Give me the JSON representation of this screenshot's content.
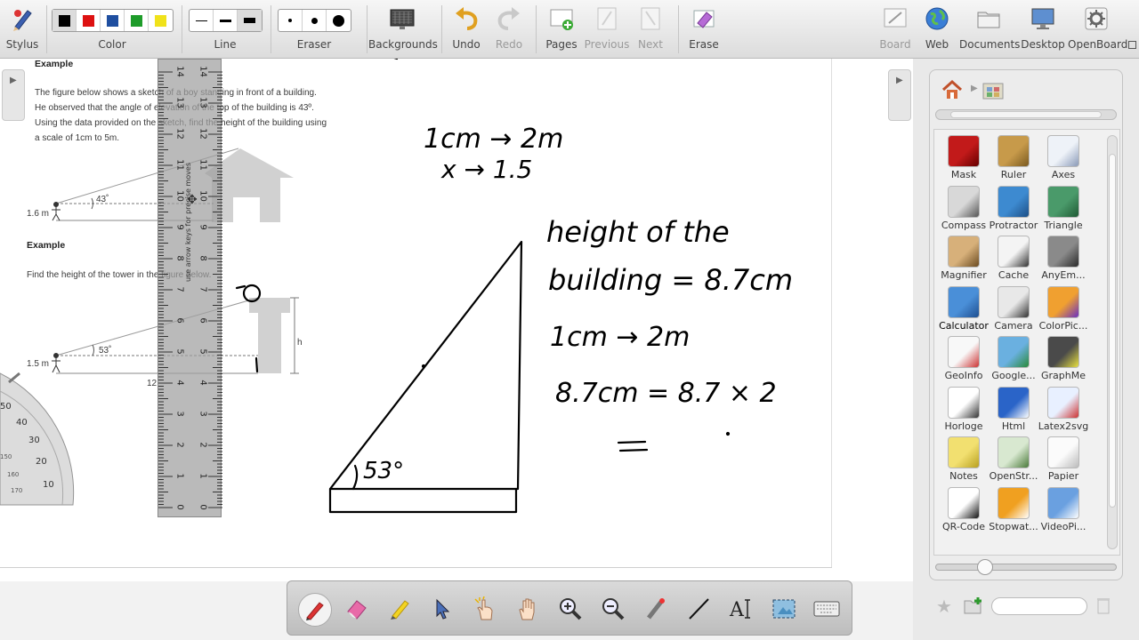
{
  "toolbar": {
    "stylus": "Stylus",
    "color": "Color",
    "line": "Line",
    "eraser": "Eraser",
    "backgrounds": "Backgrounds",
    "undo": "Undo",
    "redo": "Redo",
    "pages": "Pages",
    "previous": "Previous",
    "next": "Next",
    "erase": "Erase",
    "board": "Board",
    "web": "Web",
    "documents": "Documents",
    "desktop": "Desktop",
    "openboard": "OpenBoard"
  },
  "colors": {
    "black": "#000000",
    "red": "#dd1111",
    "blue": "#1f4fa0",
    "green": "#1e9c2a",
    "yellow": "#f0e21a"
  },
  "document": {
    "example1_title": "Example",
    "example1_text": [
      "The figure below shows a sketch of a boy standing in front of a building.",
      "He observed that the angle of elevation of the top of the building is 43º.",
      "Using the data provided on the sketch, find the height of the building using",
      "a scale of 1cm to 5m."
    ],
    "label_16m": "1.6 m",
    "angle_43": "43˚",
    "example2_title": "Example",
    "example2_text": "Find the height of the tower in the figure below.",
    "label_15m": "1.5 m",
    "angle_53": "53˚",
    "label_h": "h",
    "label_12": "12"
  },
  "ruler": {
    "hint": "use arrow keys for precise moves",
    "numbers": [
      "14",
      "13",
      "12",
      "11",
      "10",
      "9",
      "8",
      "7",
      "6",
      "5",
      "4",
      "3",
      "2",
      "1",
      "0"
    ]
  },
  "protractor": {
    "labels": [
      "50",
      "40",
      "30",
      "20",
      "10",
      "150",
      "160",
      "170"
    ]
  },
  "handwriting": {
    "scale_line1": "1cm → 2m",
    "scale_line2": "x → 1.5",
    "angle": "53°",
    "note_line1": "height of the",
    "note_line2": "building = 8.7cm",
    "note_line3": "1cm → 2m",
    "note_line4": "8.7cm = 8.7 × 2",
    "note_line5": "=",
    "stray_mark": "0"
  },
  "library": {
    "tools": [
      {
        "name": "Mask"
      },
      {
        "name": "Ruler"
      },
      {
        "name": "Axes"
      },
      {
        "name": "Compass"
      },
      {
        "name": "Protractor"
      },
      {
        "name": "Triangle"
      },
      {
        "name": "Magnifier"
      },
      {
        "name": "Cache"
      },
      {
        "name": "AnyEm..."
      },
      {
        "name": "Calculator"
      },
      {
        "name": "Camera"
      },
      {
        "name": "ColorPic..."
      },
      {
        "name": "GeoInfo"
      },
      {
        "name": "Google..."
      },
      {
        "name": "GraphMe"
      },
      {
        "name": "Horloge"
      },
      {
        "name": "Html"
      },
      {
        "name": "Latex2svg"
      },
      {
        "name": "Notes"
      },
      {
        "name": "OpenStr..."
      },
      {
        "name": "Papier"
      },
      {
        "name": "QR-Code"
      },
      {
        "name": "Stopwat..."
      },
      {
        "name": "VideoPi..."
      }
    ]
  }
}
